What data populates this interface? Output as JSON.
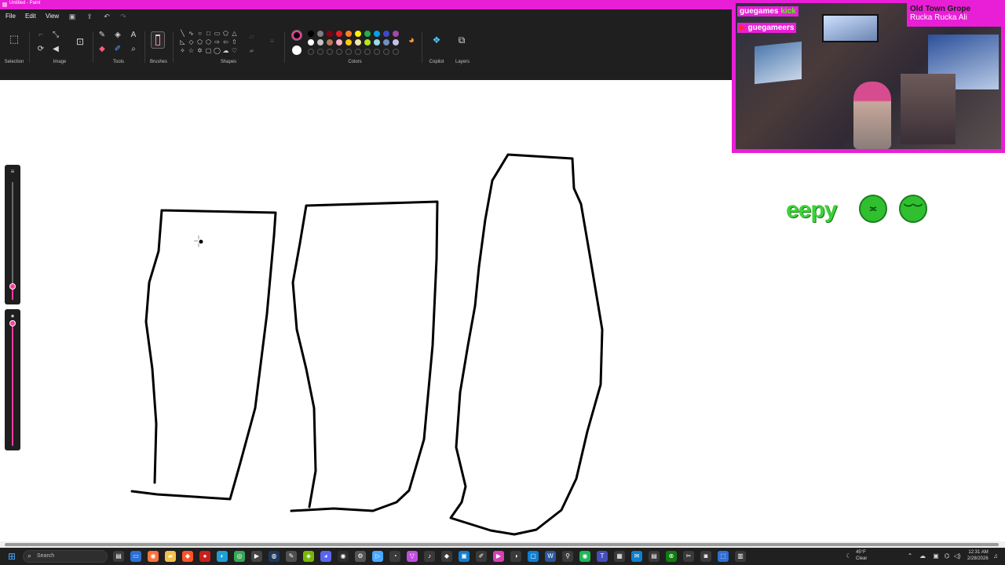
{
  "window": {
    "title": "Untitled - Paint"
  },
  "menu": {
    "file": "File",
    "edit": "Edit",
    "view": "View"
  },
  "ribbon": {
    "groups": {
      "selection": "Selection",
      "image": "Image",
      "tools": "Tools",
      "brushes": "Brushes",
      "shapes": "Shapes",
      "colors": "Colors",
      "copilot": "Copilot",
      "layers": "Layers"
    },
    "current_color_1": "#000000",
    "current_color_2": "#ffffff",
    "palette_row1": [
      "#000000",
      "#7f7f7f",
      "#880015",
      "#ed1c24",
      "#ff7f27",
      "#fff200",
      "#22b14c",
      "#00a2e8",
      "#3f48cc",
      "#a349a4"
    ],
    "palette_row2": [
      "#ffffff",
      "#c3c3c3",
      "#b97a57",
      "#ffaec9",
      "#ffc90e",
      "#efe4b0",
      "#b5e61d",
      "#99d9ea",
      "#7092be",
      "#c8bfe7"
    ]
  },
  "stream_overlay": {
    "channel_badge_name": "guegames",
    "channel_badge_platform": "kick",
    "youtube_handle": "guegameers",
    "now_playing_title": "Old Town Grope",
    "now_playing_artist": "Rucka Rucka Ali"
  },
  "emotes": {
    "eepy_text": "eepy"
  },
  "taskbar": {
    "search_placeholder": "Search",
    "weather_temp": "45°F",
    "weather_cond": "Clear",
    "time": "12:31 AM",
    "date": "2/28/2026"
  },
  "colors": {
    "accent": "#e81fd6",
    "paint_bar": "#1f1f1f",
    "slider_accent": "#ff3ba0"
  }
}
